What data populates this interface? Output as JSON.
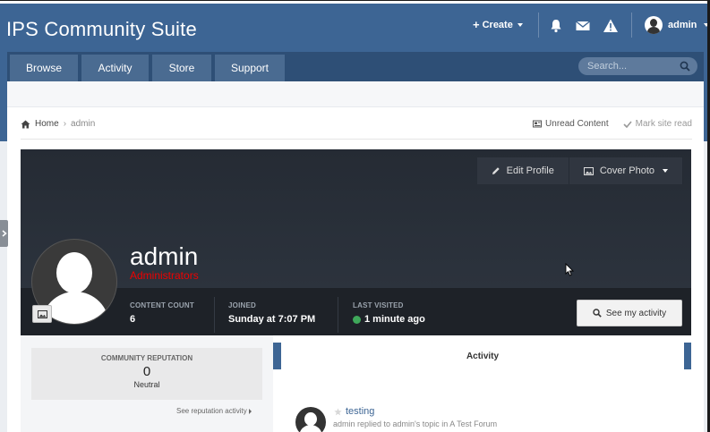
{
  "site": {
    "title": "IPS Community Suite"
  },
  "header": {
    "create_label": "Create",
    "create_plus": "+",
    "user_name": "admin",
    "icons": [
      "bell-icon",
      "envelope-icon",
      "warning-icon"
    ]
  },
  "nav": {
    "tabs": [
      {
        "label": "Browse"
      },
      {
        "label": "Activity"
      },
      {
        "label": "Store"
      },
      {
        "label": "Support"
      }
    ],
    "search_placeholder": "Search..."
  },
  "breadcrumb": {
    "home": "Home",
    "current": "admin",
    "unread": "Unread Content",
    "mark_read": "Mark site read"
  },
  "profile": {
    "edit_profile": "Edit Profile",
    "cover_photo": "Cover Photo",
    "name": "admin",
    "group": "Administrators",
    "group_color": "#e00000",
    "stats": [
      {
        "label": "CONTENT COUNT",
        "value": "6"
      },
      {
        "label": "JOINED",
        "value": "Sunday at 7:07 PM"
      },
      {
        "label": "LAST VISITED",
        "value": "1 minute ago",
        "online": true
      }
    ],
    "activity_button": "See my activity"
  },
  "reputation": {
    "label": "COMMUNITY REPUTATION",
    "value": "0",
    "word": "Neutral",
    "link": "See reputation activity"
  },
  "activity": {
    "heading": "Activity",
    "feed": [
      {
        "title": "testing",
        "meta": "admin replied to admin's topic in A Test Forum"
      }
    ]
  },
  "colors": {
    "brand": "#3d6594",
    "nav_strip": "#2e4f76",
    "cover": "#252b34",
    "online": "#3fa85a"
  }
}
